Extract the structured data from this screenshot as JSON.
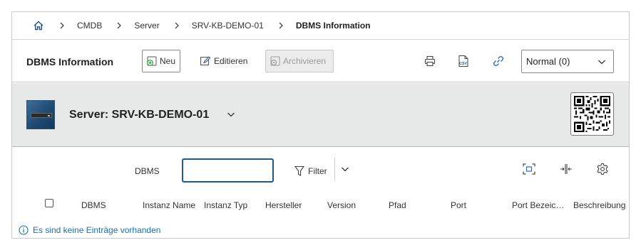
{
  "breadcrumb": {
    "home_icon": "home-icon",
    "items": [
      "CMDB",
      "Server",
      "SRV-KB-DEMO-01",
      "DBMS Information"
    ]
  },
  "toolbar": {
    "title": "DBMS Information",
    "new_label": "Neu",
    "edit_label": "Editieren",
    "archive_label": "Archivieren",
    "icons": [
      "print-icon",
      "csv-export-icon",
      "link-icon"
    ],
    "view_select": "Normal (0)"
  },
  "object": {
    "title": "Server: SRV-KB-DEMO-01",
    "image_icon": "server-icon",
    "qr_icon": "qr-code-icon"
  },
  "filter": {
    "label": "DBMS",
    "input_value": "",
    "filter_label": "Filter",
    "tool_icons": [
      "expand-icon",
      "column-width-icon",
      "settings-icon"
    ]
  },
  "table": {
    "columns": [
      "DBMS",
      "Instanz Name",
      "Instanz Typ",
      "Hersteller",
      "Version",
      "Pfad",
      "Port",
      "Port Bezeichnung",
      "Beschreibung"
    ]
  },
  "empty_message": "Es sind keine Einträge vorhanden",
  "colors": {
    "accent": "#1f5b8a",
    "link": "#1d6ea8",
    "header_bg": "#e7e8e8",
    "new_icon_green": "#2e9a3e"
  }
}
